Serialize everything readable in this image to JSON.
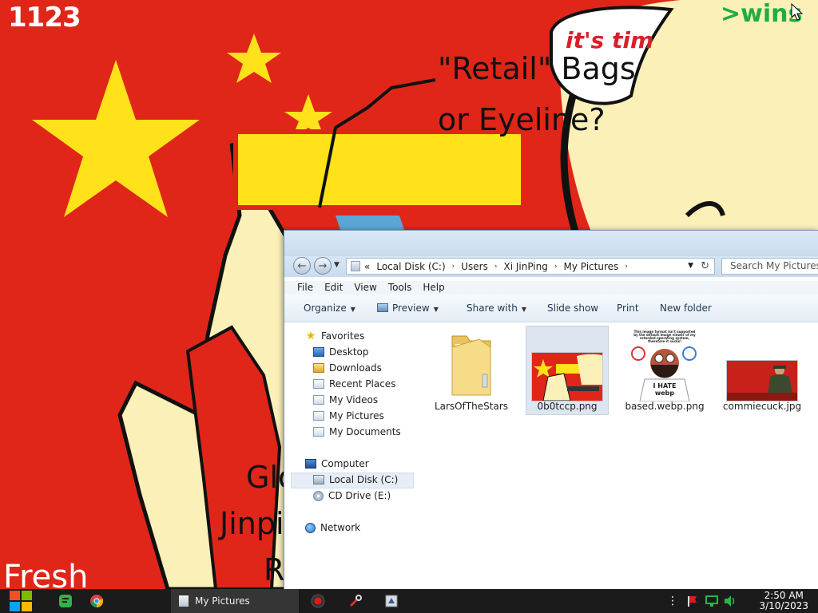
{
  "wallpaper": {
    "counter_text": "1123",
    "caption_line1": "\"Retail\" Bags",
    "caption_line2": "or Eyeline?",
    "bubble_text": "it's tim",
    "green_text": ">wins",
    "left_text_1": "Glo",
    "left_text_2": "Jinpi",
    "left_text_3": "R",
    "corner_text": "Fresh",
    "colors": {
      "flag_red": "#e02619",
      "star_yellow": "#ffe21a",
      "skin": "#faf0b8"
    }
  },
  "explorer": {
    "address": {
      "overflow": "«",
      "crumbs": [
        "Local Disk (C:)",
        "Users",
        "Xi JinPing",
        "My Pictures"
      ],
      "separator": "›"
    },
    "search_placeholder": "Search My Pictures",
    "menu": [
      "File",
      "Edit",
      "View",
      "Tools",
      "Help"
    ],
    "commands": {
      "organize": "Organize",
      "preview": "Preview",
      "share": "Share with",
      "slide_show": "Slide show",
      "print": "Print",
      "new_folder": "New folder"
    },
    "nav": {
      "favorites": "Favorites",
      "desktop": "Desktop",
      "downloads": "Downloads",
      "recent_places": "Recent Places",
      "my_videos": "My Videos",
      "my_pictures": "My Pictures",
      "my_documents": "My Documents",
      "computer": "Computer",
      "local_disk": "Local Disk (C:)",
      "cd_drive": "CD Drive (E:)",
      "network": "Network"
    },
    "files": [
      {
        "name": "LarsOfTheStars",
        "type": "folder"
      },
      {
        "name": "0b0tccp.png",
        "type": "image",
        "selected": true
      },
      {
        "name": "based.webp.png",
        "type": "image",
        "thumb_text_top": "This image format isn't supported by the default image viewer of my retarded operating system, therefore it sucks!",
        "thumb_text_bottom": "I HATE webp"
      },
      {
        "name": "commiecuck.jpg",
        "type": "image"
      }
    ]
  },
  "taskbar": {
    "active_window": "My Pictures",
    "time": "2:50 AM",
    "date": "3/10/2023",
    "icons": [
      "start-icon",
      "notes-icon",
      "chrome-icon",
      "record-icon",
      "tool-icon",
      "app-icon",
      "more-icon",
      "flag-icon",
      "network-icon",
      "volume-icon"
    ]
  }
}
